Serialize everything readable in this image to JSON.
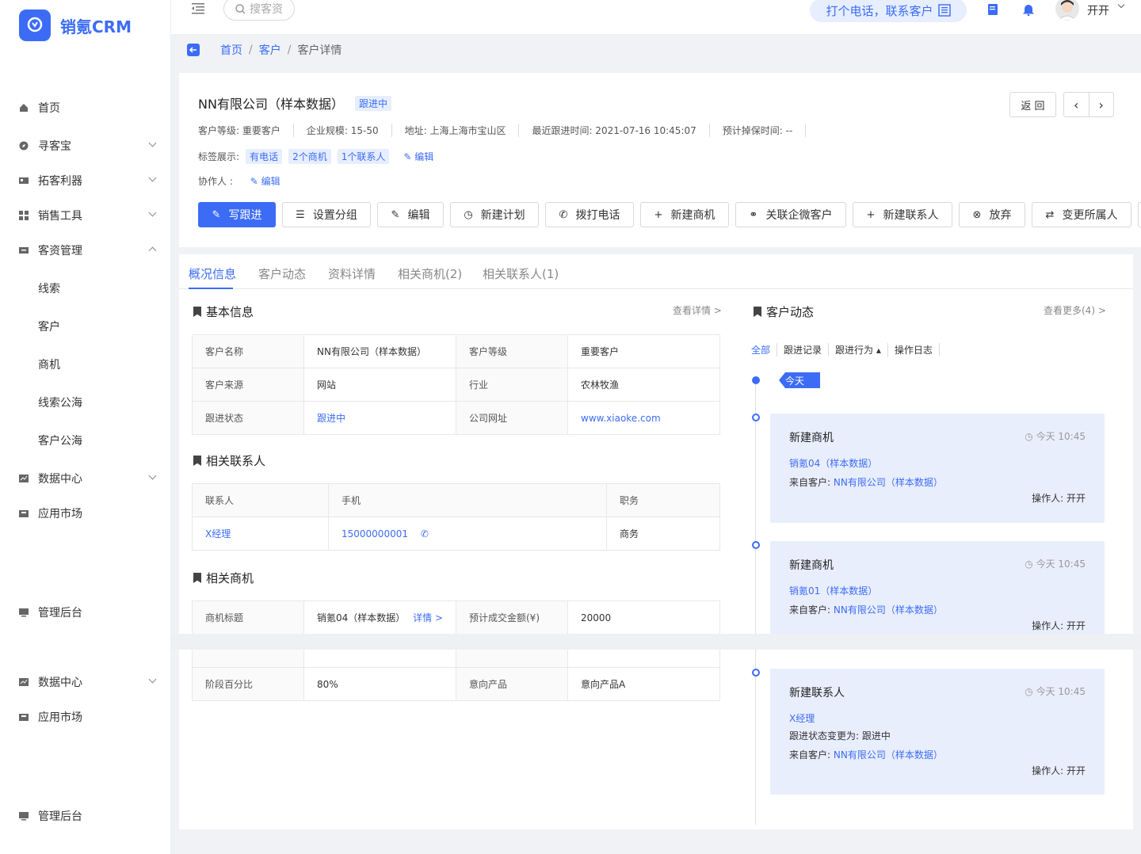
{
  "brand": {
    "name": "销氪CRM"
  },
  "sidebar": {
    "items": [
      {
        "label": "首页"
      },
      {
        "label": "寻客宝"
      },
      {
        "label": "拓客利器"
      },
      {
        "label": "销售工具"
      },
      {
        "label": "客资管理"
      },
      {
        "label": "数据中心"
      },
      {
        "label": "应用市场"
      },
      {
        "label": "管理后台"
      }
    ],
    "sub_items": [
      {
        "label": "线索"
      },
      {
        "label": "客户"
      },
      {
        "label": "商机"
      },
      {
        "label": "线索公海"
      },
      {
        "label": "客户公海"
      }
    ],
    "repeat": [
      {
        "label": "数据中心"
      },
      {
        "label": "应用市场"
      },
      {
        "label": "管理后台"
      }
    ]
  },
  "header": {
    "search_placeholder": "搜客资",
    "call_label": "打个电话，联系客户",
    "user_name": "开开"
  },
  "breadcrumb": {
    "home": "首页",
    "customers": "客户",
    "current": "客户详情"
  },
  "customer": {
    "title": "NN有限公司（样本数据）",
    "status": "跟进中",
    "meta": [
      "客户等级:  重要客户",
      "企业规模:  15-50",
      "地址:  上海上海市宝山区",
      "最近跟进时间:  2021-07-16 10:45:07",
      "预计掉保时间:  --"
    ],
    "tags_label": "标签展示:",
    "tags": [
      "有电话",
      "2个商机",
      "1个联系人"
    ],
    "edit": "编辑",
    "collab_label": "协作人 :",
    "back": "返 回"
  },
  "actions": [
    "写跟进",
    "设置分组",
    "编辑",
    "新建计划",
    "拨打电话",
    "新建商机",
    "关联企微客户",
    "新建联系人",
    "放弃",
    "变更所属人"
  ],
  "tabs": [
    "概况信息",
    "客户动态",
    "资料详情",
    "相关商机(2)",
    "相关联系人(1)"
  ],
  "basic": {
    "title": "基本信息",
    "more": "查看详情 >",
    "rows": [
      [
        "客户名称",
        "NN有限公司（样本数据）",
        "客户等级",
        "重要客户"
      ],
      [
        "客户来源",
        "网站",
        "行业",
        "农林牧渔"
      ],
      [
        "跟进状态",
        "跟进中",
        "公司网址",
        "www.xiaoke.com"
      ]
    ]
  },
  "contacts": {
    "title": "相关联系人",
    "headers": [
      "联系人",
      "手机",
      "职务"
    ],
    "row": [
      "X经理",
      "15000000001",
      "商务"
    ]
  },
  "deals": {
    "title": "相关商机",
    "row1": [
      "商机标题",
      "销氪04（样本数据）",
      "详情 >",
      "预计成交金额(¥)",
      "20000"
    ],
    "row2": [
      "阶段百分比",
      "80%",
      "意向产品",
      "意向产品A"
    ]
  },
  "timeline": {
    "title": "客户动态",
    "more": "查看更多(4) >",
    "filters": [
      "全部",
      "跟进记录",
      "跟进行为 ▴",
      "操作日志"
    ],
    "today": "今天",
    "cards": [
      {
        "title": "新建商机",
        "time": "今天 10:45",
        "link": "销氪04（样本数据）",
        "from_label": "来自客户:",
        "from": "NN有限公司（样本数据）",
        "op": "操作人:  开开"
      },
      {
        "title": "新建商机",
        "time": "今天 10:45",
        "link": "销氪01（样本数据）",
        "from_label": "来自客户:",
        "from": "NN有限公司（样本数据）",
        "op": "操作人:  开开"
      },
      {
        "title": "新建联系人",
        "time": "今天 10:45",
        "link": "X经理",
        "status_change": "跟进状态变更为:  跟进中",
        "from_label": "来自客户:",
        "from": "NN有限公司（样本数据）",
        "op": "操作人:  开开"
      }
    ]
  }
}
